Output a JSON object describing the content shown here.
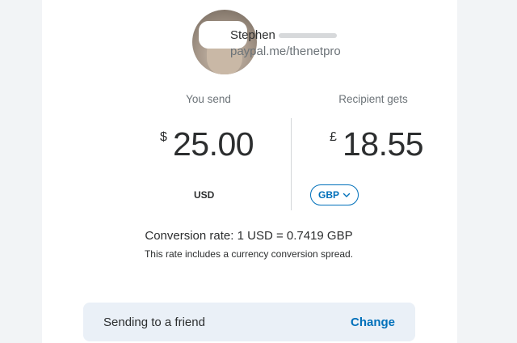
{
  "recipient": {
    "first_name": "Stephen",
    "handle": "paypal.me/thenetpro"
  },
  "send": {
    "label": "You send",
    "symbol": "$",
    "amount": "25.00",
    "currency": "USD"
  },
  "receive": {
    "label": "Recipient gets",
    "symbol": "£",
    "amount": "18.55",
    "currency": "GBP"
  },
  "conversion": {
    "rate_text": "Conversion rate: 1 USD = 0.7419 GBP",
    "note": "This rate includes a currency conversion spread."
  },
  "payment_type": {
    "label": "Sending to a friend",
    "change_label": "Change"
  },
  "colors": {
    "accent": "#0070ba",
    "bar_bg": "#eaf0f7",
    "page_bg": "#f2f4f6"
  },
  "icons": {
    "currency_dropdown": "chevron-down-icon"
  }
}
